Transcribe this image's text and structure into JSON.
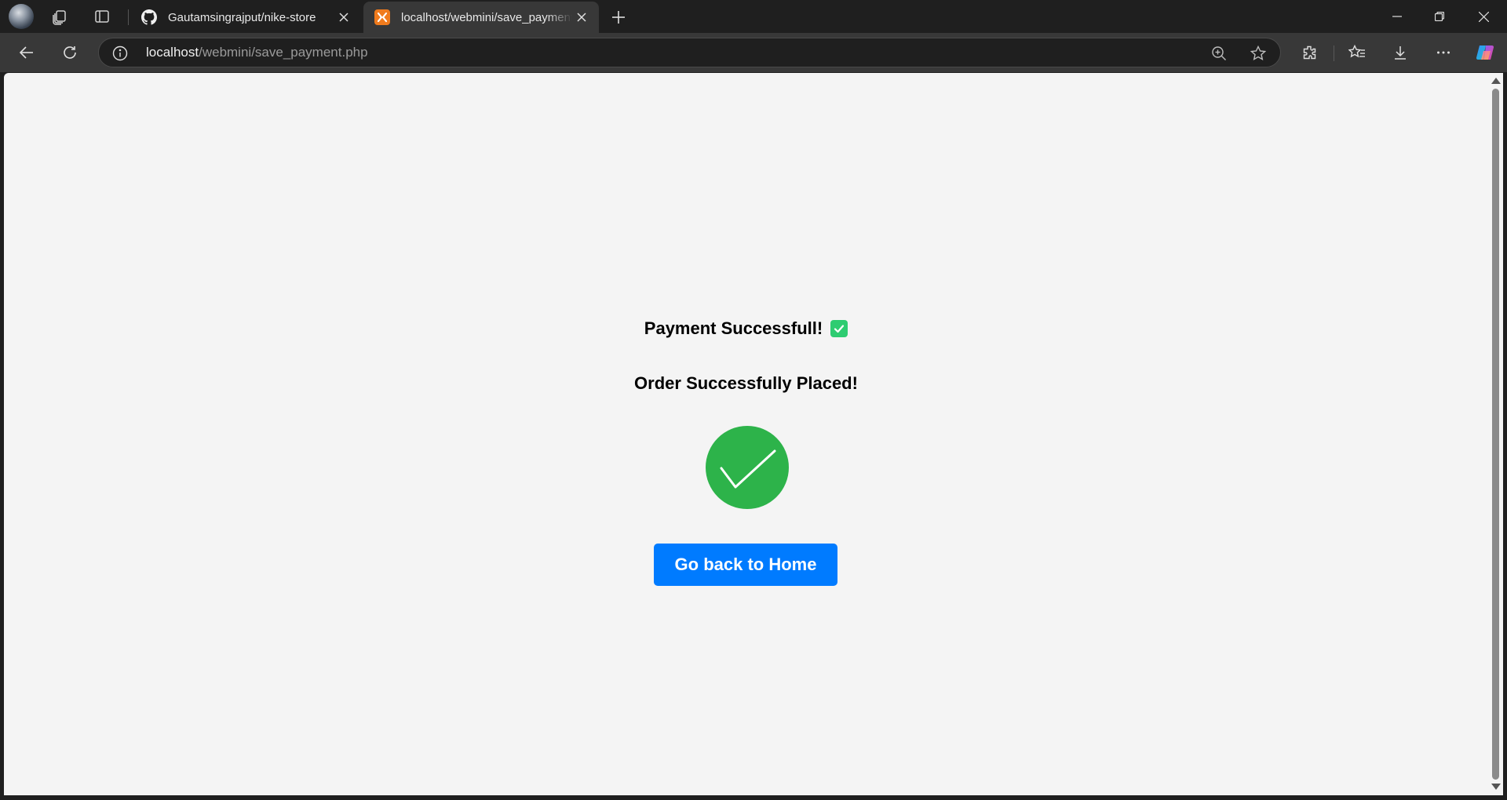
{
  "browser": {
    "tabs": [
      {
        "title": "Gautamsingrajput/nike-store",
        "favicon": "github-icon",
        "active": false
      },
      {
        "title": "localhost/webmini/save_payment.php",
        "favicon": "xampp-icon",
        "active": true
      }
    ],
    "address": {
      "host": "localhost",
      "path": "/webmini/save_payment.php"
    }
  },
  "page": {
    "payment_message": "Payment Successfull!",
    "order_message": "Order Successfully Placed!",
    "home_button_label": "Go back to Home"
  },
  "colors": {
    "page_background": "#f4f4f4",
    "success_green": "#2db34a",
    "emoji_green": "#2ecc71",
    "button_blue": "#007bff",
    "browser_chrome": "#1f1f1f",
    "active_tab": "#383838"
  }
}
